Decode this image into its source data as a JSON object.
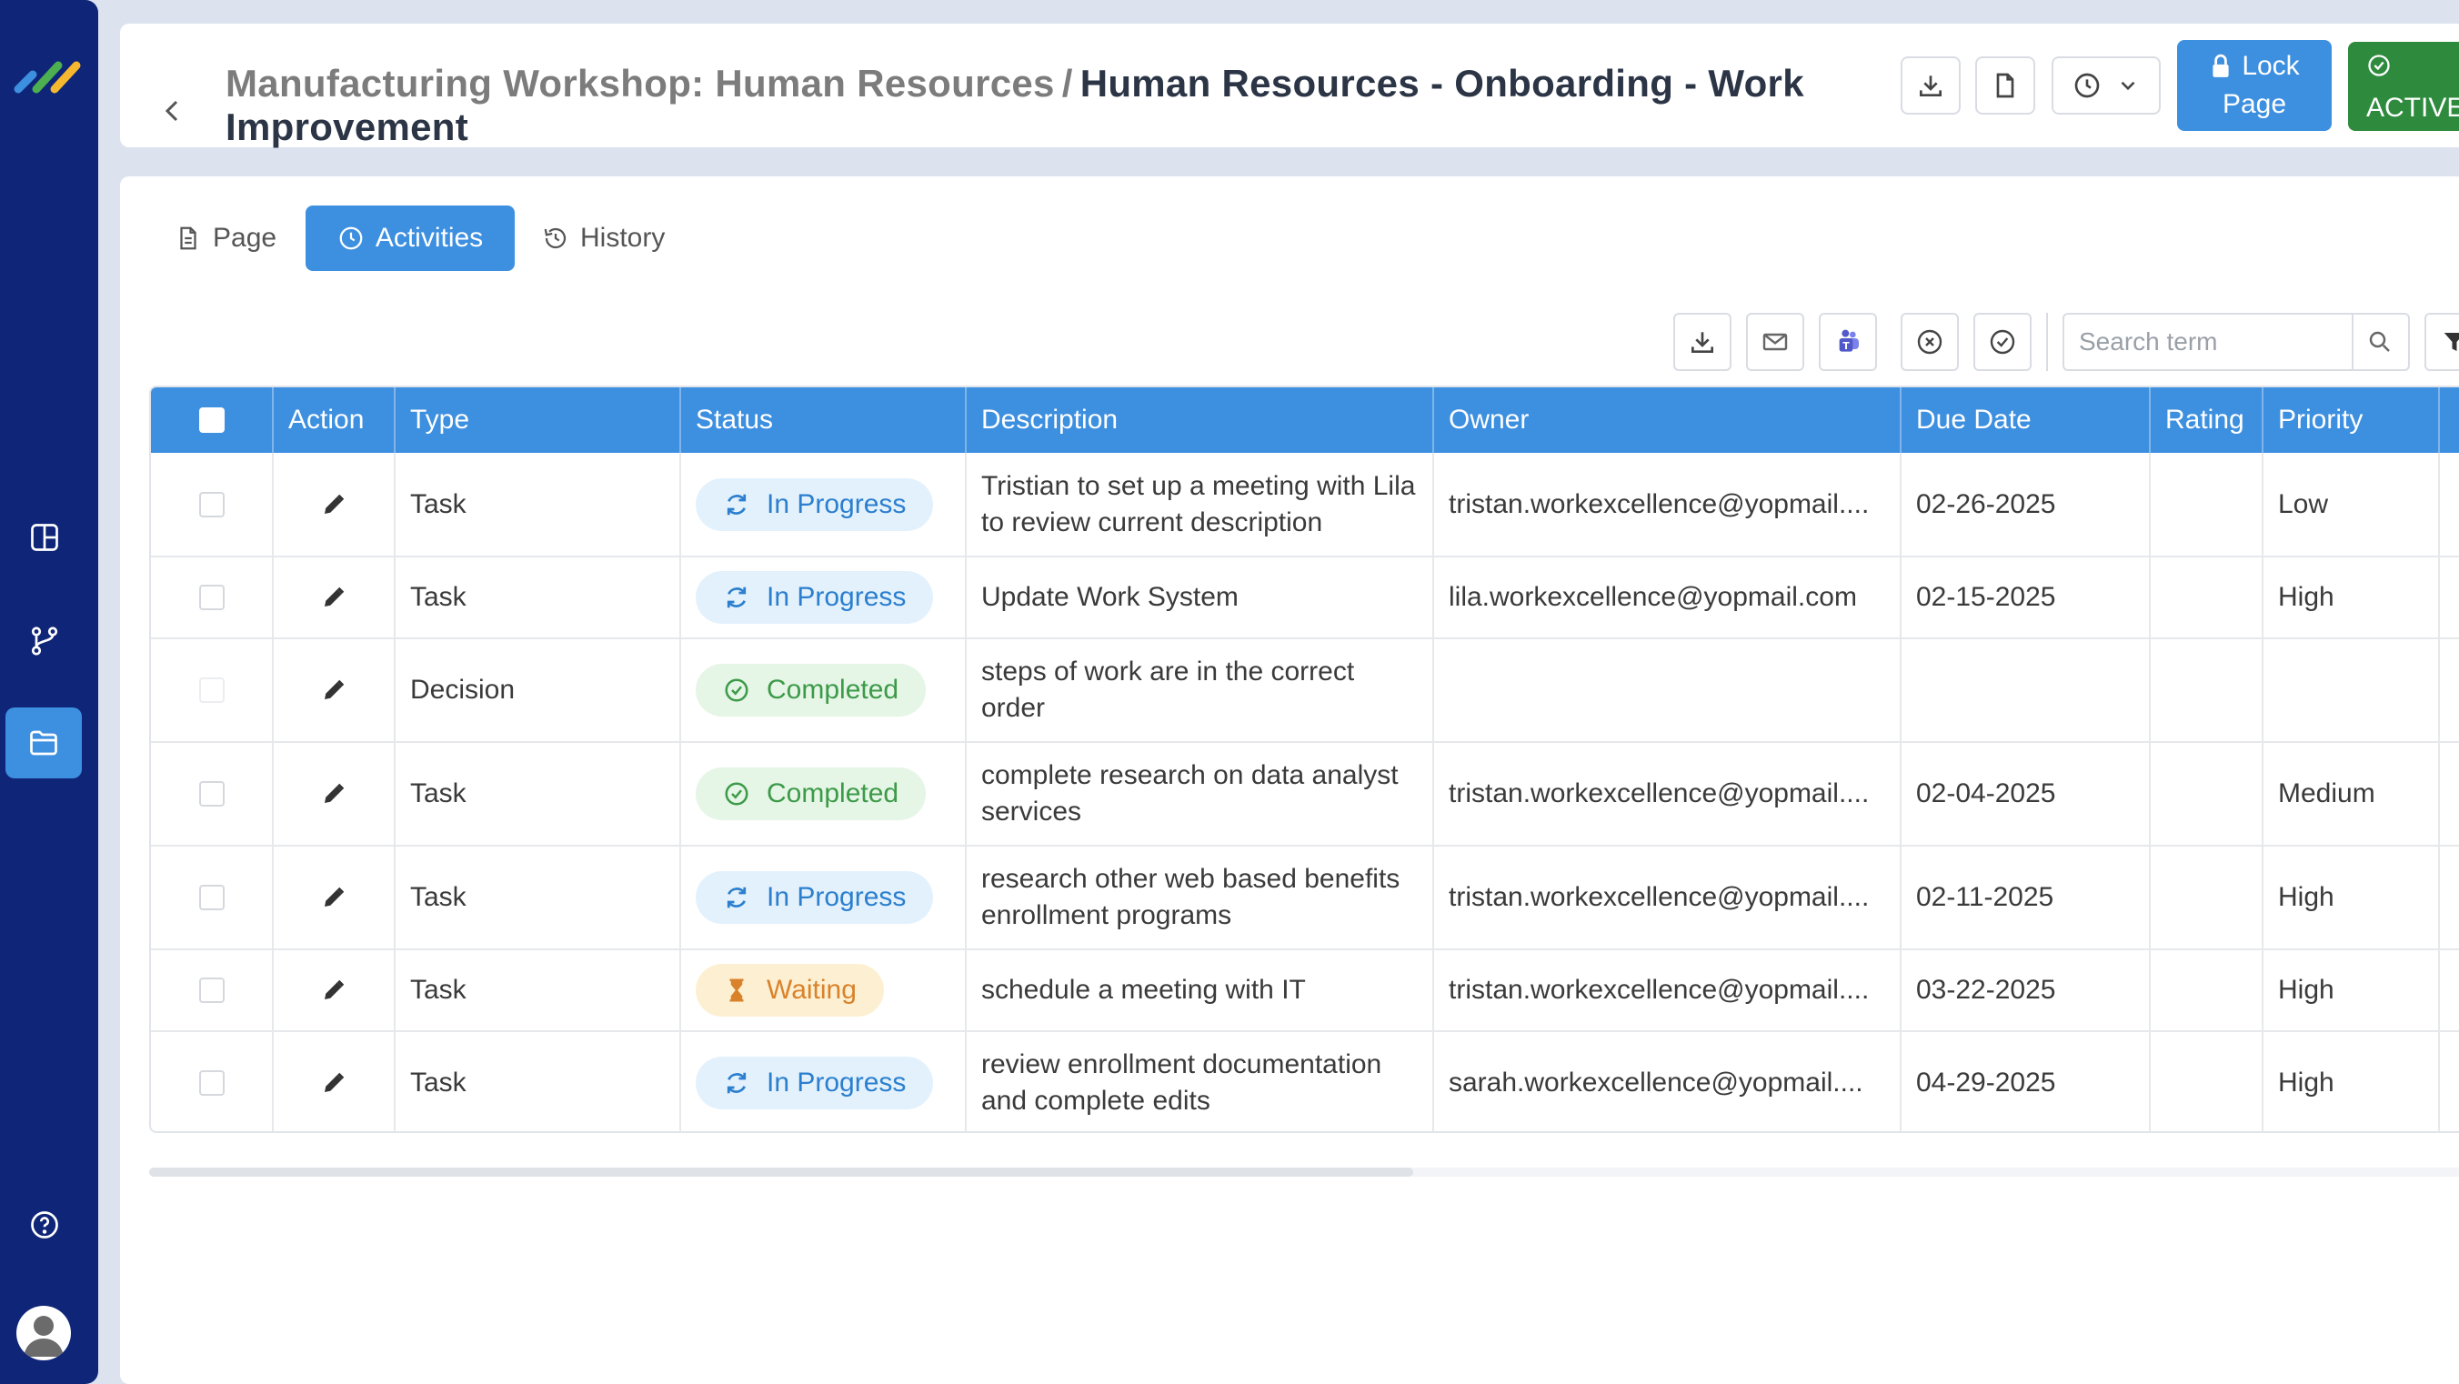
{
  "header": {
    "breadcrumb_parent": "Manufacturing Workshop: Human Resources",
    "breadcrumb_separator": "/",
    "page_title": "Human Resources - Onboarding - Work Improvement",
    "lock_label_line1": "Lock",
    "lock_label_line2": "Page",
    "active_label": "ACTIVE"
  },
  "tabs": [
    {
      "label": "Page",
      "icon": "document-icon"
    },
    {
      "label": "Activities",
      "icon": "clock-icon"
    },
    {
      "label": "History",
      "icon": "history-icon"
    }
  ],
  "search": {
    "placeholder": "Search term"
  },
  "table": {
    "columns": [
      "Action",
      "Type",
      "Status",
      "Description",
      "Owner",
      "Due Date",
      "Rating",
      "Priority"
    ],
    "rows": [
      {
        "type": "Task",
        "status": "In Progress",
        "description": "Tristian to set up a meeting with Lila to review current description",
        "owner": "tristan.workexcellence@yopmail....",
        "due": "02-26-2025",
        "rating": "",
        "priority": "Low"
      },
      {
        "type": "Task",
        "status": "In Progress",
        "description": "Update Work System",
        "owner": "lila.workexcellence@yopmail.com",
        "due": "02-15-2025",
        "rating": "",
        "priority": "High"
      },
      {
        "type": "Decision",
        "status": "Completed",
        "description": "steps of work are in the correct order",
        "owner": "",
        "due": "",
        "rating": "",
        "priority": ""
      },
      {
        "type": "Task",
        "status": "Completed",
        "description": "complete research on data analyst services",
        "owner": "tristan.workexcellence@yopmail....",
        "due": "02-04-2025",
        "rating": "",
        "priority": "Medium"
      },
      {
        "type": "Task",
        "status": "In Progress",
        "description": "research other web based benefits enrollment programs",
        "owner": "tristan.workexcellence@yopmail....",
        "due": "02-11-2025",
        "rating": "",
        "priority": "High"
      },
      {
        "type": "Task",
        "status": "Waiting",
        "description": "schedule a meeting with IT",
        "owner": "tristan.workexcellence@yopmail....",
        "due": "03-22-2025",
        "rating": "",
        "priority": "High"
      },
      {
        "type": "Task",
        "status": "In Progress",
        "description": "review enrollment documentation and complete edits",
        "owner": "sarah.workexcellence@yopmail....",
        "due": "04-29-2025",
        "rating": "",
        "priority": "High"
      }
    ]
  },
  "colors": {
    "sidebar": "#0f2578",
    "accent": "#3d8fe0",
    "active_green": "#2e8b3e",
    "in_progress": "#2b7fce",
    "completed": "#3c9a48",
    "waiting": "#d9822b"
  }
}
